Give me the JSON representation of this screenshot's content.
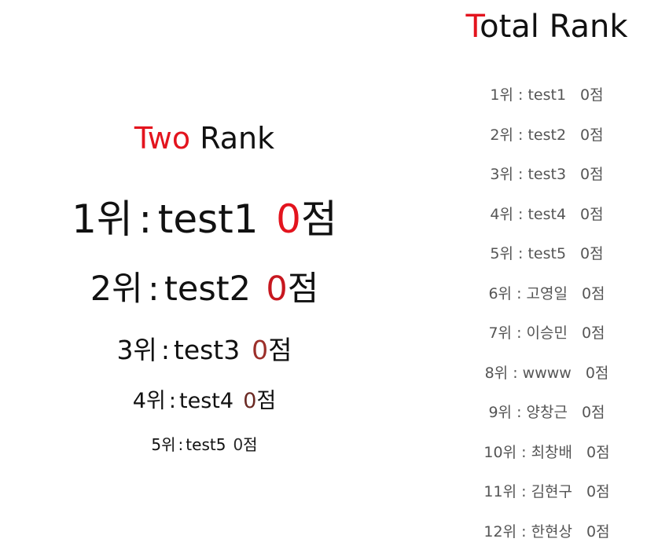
{
  "two_rank": {
    "title_accent": "Two",
    "title_rest": " Rank",
    "entries": [
      {
        "rank": "1위",
        "sep": ":",
        "name": "test1",
        "score": "0",
        "unit": "점"
      },
      {
        "rank": "2위",
        "sep": ":",
        "name": "test2",
        "score": "0",
        "unit": "점"
      },
      {
        "rank": "3위",
        "sep": ":",
        "name": "test3",
        "score": "0",
        "unit": "점"
      },
      {
        "rank": "4위",
        "sep": ":",
        "name": "test4",
        "score": "0",
        "unit": "점"
      },
      {
        "rank": "5위",
        "sep": ":",
        "name": "test5",
        "score": "0",
        "unit": "점"
      }
    ]
  },
  "total_rank": {
    "title_accent": "T",
    "title_rest": "otal Rank",
    "entries": [
      {
        "rank": "1위",
        "sep": ":",
        "name": "test1",
        "score": "0점"
      },
      {
        "rank": "2위",
        "sep": ":",
        "name": "test2",
        "score": "0점"
      },
      {
        "rank": "3위",
        "sep": ":",
        "name": "test3",
        "score": "0점"
      },
      {
        "rank": "4위",
        "sep": ":",
        "name": "test4",
        "score": "0점"
      },
      {
        "rank": "5위",
        "sep": ":",
        "name": "test5",
        "score": "0점"
      },
      {
        "rank": "6위",
        "sep": ":",
        "name": "고영일",
        "score": "0점"
      },
      {
        "rank": "7위",
        "sep": ":",
        "name": "이승민",
        "score": "0점"
      },
      {
        "rank": "8위",
        "sep": ":",
        "name": "wwww",
        "score": "0점"
      },
      {
        "rank": "9위",
        "sep": ":",
        "name": "양창근",
        "score": "0점"
      },
      {
        "rank": "10위",
        "sep": ":",
        "name": "최창배",
        "score": "0점"
      },
      {
        "rank": "11위",
        "sep": ":",
        "name": "김현구",
        "score": "0점"
      },
      {
        "rank": "12위",
        "sep": ":",
        "name": "한현상",
        "score": "0점"
      }
    ]
  },
  "colors": {
    "accent": "#e3141e",
    "text": "#111111",
    "muted": "#555555"
  }
}
